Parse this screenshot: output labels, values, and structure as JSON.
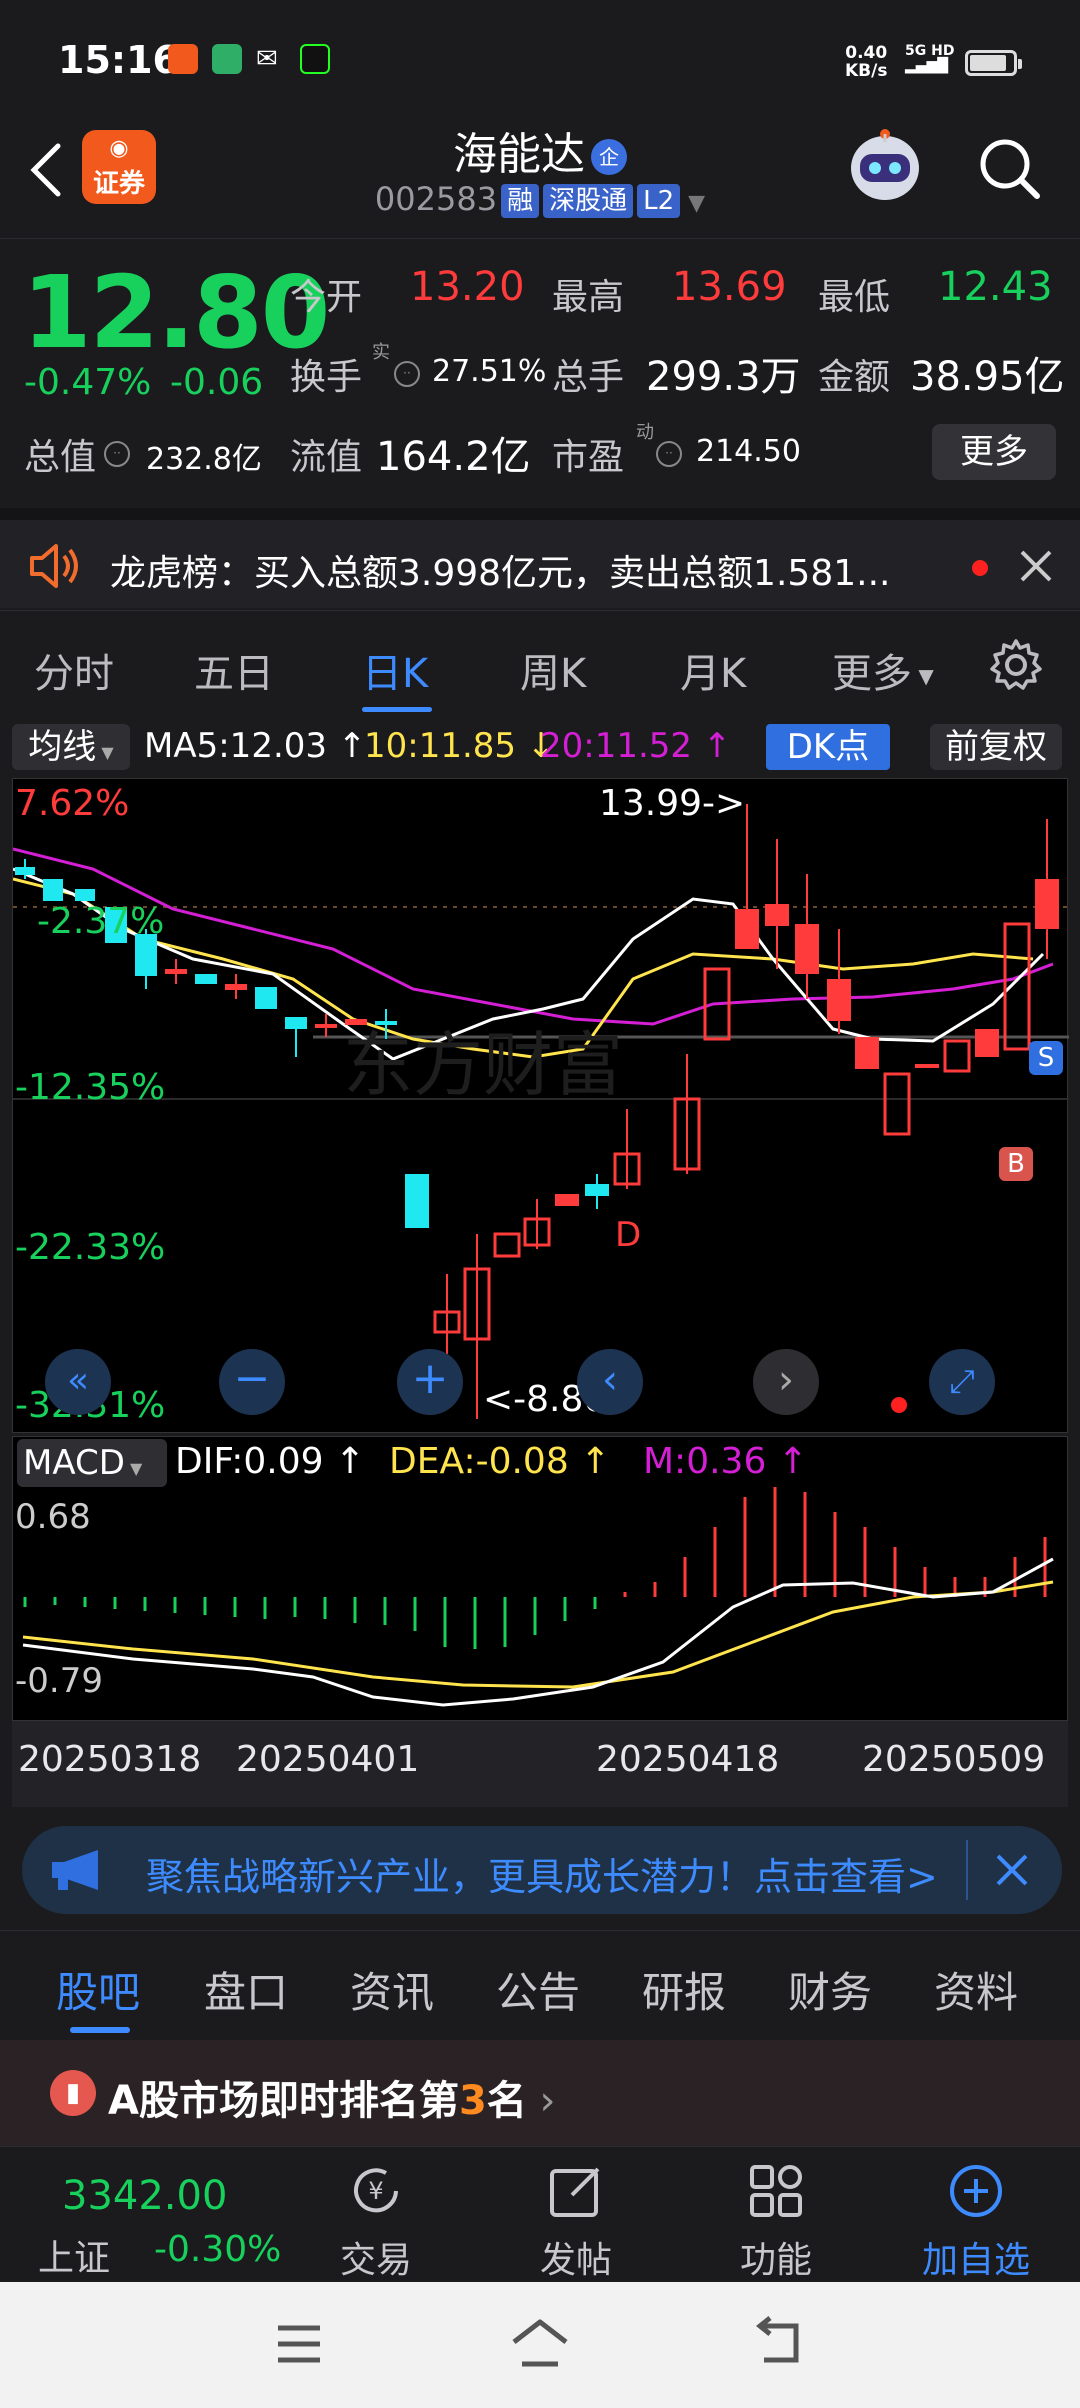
{
  "status_bar": {
    "time": "15:16",
    "net_speed": "0.40",
    "net_unit": "KB/s",
    "signal": "5G HD"
  },
  "header": {
    "app_logo_text": "证券",
    "stock_name": "海能达",
    "enterprise_badge": "企",
    "stock_code": "002583",
    "tags": [
      "融",
      "深股通",
      "L2"
    ]
  },
  "quote": {
    "price": "12.80",
    "change_pct": "-0.47%",
    "change": "-0.06",
    "open_label": "今开",
    "open": "13.20",
    "high_label": "最高",
    "high": "13.69",
    "low_label": "最低",
    "low": "12.43",
    "turnover_label": "换手",
    "turnover_sup": "实",
    "turnover": "27.51%",
    "volume_label": "总手",
    "volume": "299.3万",
    "amount_label": "金额",
    "amount": "38.95亿",
    "mktcap_label": "总值",
    "mktcap": "232.8亿",
    "float_label": "流值",
    "float_cap": "164.2亿",
    "pe_label": "市盈",
    "pe_sup": "动",
    "pe": "214.50",
    "more_label": "更多"
  },
  "news": {
    "text": "龙虎榜：买入总额3.998亿元，卖出总额1.581..."
  },
  "period_tabs": {
    "items": [
      "分时",
      "五日",
      "日K",
      "周K",
      "月K",
      "更多"
    ],
    "active": "日K"
  },
  "indicator_bar": {
    "ma_select": "均线",
    "ma5": "MA5:12.03",
    "ma10": "10:11.85",
    "ma20": "20:11.52",
    "dk_label": "DK点",
    "adjust_label": "前复权"
  },
  "main_chart": {
    "pct_labels": [
      "7.62%",
      "-2.37%",
      "-12.35%",
      "-22.33%",
      "-32.31%"
    ],
    "high_marker": "13.99->",
    "low_marker": "<-8.80",
    "signal_d": "D",
    "signal_s": "S",
    "signal_b": "B"
  },
  "macd": {
    "select": "MACD",
    "dif": "DIF:0.09",
    "dea": "DEA:-0.08",
    "m": "M:0.36",
    "top_label": "0.68",
    "bottom_label": "-0.79"
  },
  "dates": [
    "20250318",
    "20250401",
    "20250418",
    "20250509"
  ],
  "chart_data": {
    "type": "candlestick",
    "categories": [
      "20250318",
      "20250401",
      "20250418",
      "20250509"
    ],
    "ma": {
      "ma5": 12.03,
      "ma10": 11.85,
      "ma20": 11.52
    },
    "price_high_marker": 13.99,
    "price_low_marker": 8.8,
    "macd": {
      "dif": 0.09,
      "dea": -0.08,
      "m": 0.36,
      "ylim": [
        -0.79,
        0.68
      ]
    }
  },
  "promo": {
    "text": "聚焦战略新兴产业，更具成长潜力！点击查看>"
  },
  "section_tabs": {
    "items": [
      "股吧",
      "盘口",
      "资讯",
      "公告",
      "研报",
      "财务",
      "资料"
    ],
    "active": "股吧"
  },
  "rank": {
    "prefix": "A股市场即时排名第",
    "num": "3",
    "suffix": "名"
  },
  "footer": {
    "index_value": "3342.00",
    "index_name": "上证",
    "index_change": "-0.30%",
    "items": [
      "交易",
      "发帖",
      "功能",
      "加自选"
    ]
  },
  "colors": {
    "up": "#ff3b3b",
    "down": "#18d15d",
    "accent": "#3d8bff",
    "candle_down": "#20e8f0",
    "ma5": "#ffffff",
    "ma10": "#ffe44d",
    "ma20": "#d41fd4"
  }
}
